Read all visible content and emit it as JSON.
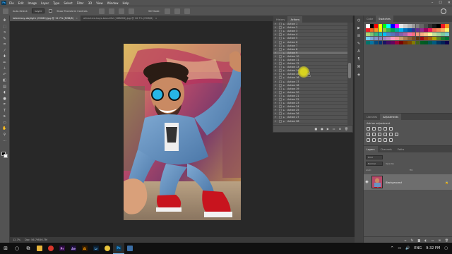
{
  "menu": {
    "logo": "Ps",
    "items": [
      "File",
      "Edit",
      "Image",
      "Layer",
      "Type",
      "Select",
      "Filter",
      "3D",
      "View",
      "Window",
      "Help"
    ]
  },
  "options": {
    "mode_value": "Layer",
    "auto_select_label": "Auto-Select:",
    "transform_label": "Show Transform Controls",
    "mode_3d": "3D Mode:"
  },
  "tabs": [
    {
      "label": "latest-boy-daylight (09060).jpg @ 12.7% (RGB/8)",
      "active": true
    },
    {
      "label": "attractive-boys-beautiful (188806).jpg @ 16.7% (RGB/8)",
      "active": false
    }
  ],
  "status": {
    "zoom": "12.7%",
    "doc": "Doc: 56.7M/56.7M"
  },
  "actions_panel": {
    "tabs": [
      "History",
      "Actions"
    ],
    "active_tab": "Actions",
    "items": [
      "Action 1",
      "Action 2",
      "Action 3",
      "Action 4",
      "Action 5",
      "Action 6",
      "Action 7",
      "Action 8",
      "Action 9",
      "Action 10",
      "Action 11",
      "Action 12",
      "Action 13",
      "Action 14",
      "Action 15",
      "Action 16",
      "Action 17",
      "Action 18",
      "Action 19",
      "Action 20",
      "Action 21",
      "Action 22",
      "Action 23",
      "Action 24",
      "Action 25",
      "Action 26",
      "Action 27",
      "Action 28"
    ],
    "highlighted_index": 8
  },
  "swatches_panel": {
    "tabs": [
      "Color",
      "Swatches"
    ],
    "active_tab": "Swatches",
    "colors": [
      "#ffffff",
      "#000000",
      "#ff0000",
      "#ffff00",
      "#00ff00",
      "#00ffff",
      "#0000ff",
      "#ff00ff",
      "#e6e6e6",
      "#cccccc",
      "#b3b3b3",
      "#999999",
      "#808080",
      "#666666",
      "#4d4d4d",
      "#333333",
      "#1a1a1a",
      "#000000",
      "#ed1c24",
      "#f7941d",
      "#ed1c24",
      "#f26522",
      "#f7941d",
      "#fff200",
      "#8dc63f",
      "#39b54a",
      "#00a651",
      "#00a99d",
      "#00aeef",
      "#0072bc",
      "#0054a6",
      "#2e3192",
      "#662d91",
      "#92278f",
      "#9e005d",
      "#ed145b",
      "#f26c4f",
      "#f68e55",
      "#fbaf5d",
      "#fff568",
      "#acd372",
      "#7cc576",
      "#3bb878",
      "#1abbb4",
      "#00bff3",
      "#438cca",
      "#5574b9",
      "#605ca8",
      "#855fa8",
      "#a763a8",
      "#f06eaa",
      "#f26d7d",
      "#f7977a",
      "#f9ad81",
      "#fdc68a",
      "#fff79a",
      "#c4df9b",
      "#a3d39c",
      "#82ca9d",
      "#7bcdc8",
      "#6ecff6",
      "#7ea7d8",
      "#8493ca",
      "#8882be",
      "#a187be",
      "#bc8dbf",
      "#f49ac2",
      "#f5989d",
      "#c69c6d",
      "#a67c52",
      "#8c6239",
      "#754c24",
      "#603913",
      "#9e0b0f",
      "#a0410d",
      "#a36209",
      "#aba000",
      "#598527",
      "#1a7b30",
      "#007236",
      "#00746b",
      "#0076a3",
      "#004b80",
      "#003471",
      "#1b1464",
      "#440e62",
      "#630460",
      "#9e0039",
      "#790000",
      "#7b2e00",
      "#7d4900",
      "#827b00",
      "#406618",
      "#005e20",
      "#005826",
      "#005952",
      "#005b7f",
      "#003663",
      "#002157",
      "#0d004c"
    ]
  },
  "adjustments_panel": {
    "tabs": [
      "Libraries",
      "Adjustments"
    ],
    "active_tab": "Adjustments",
    "title": "Add an adjustment"
  },
  "layers_panel": {
    "tabs": [
      "Layers",
      "Channels",
      "Paths"
    ],
    "active_tab": "Layers",
    "kind_label": "Kind",
    "blend_mode": "Normal",
    "opacity_label": "Opacity:",
    "lock_label": "Lock:",
    "fill_label": "Fill:",
    "layer_name": "Background"
  },
  "taskbar": {
    "time": "9:32 PM",
    "lang": "ENG"
  }
}
